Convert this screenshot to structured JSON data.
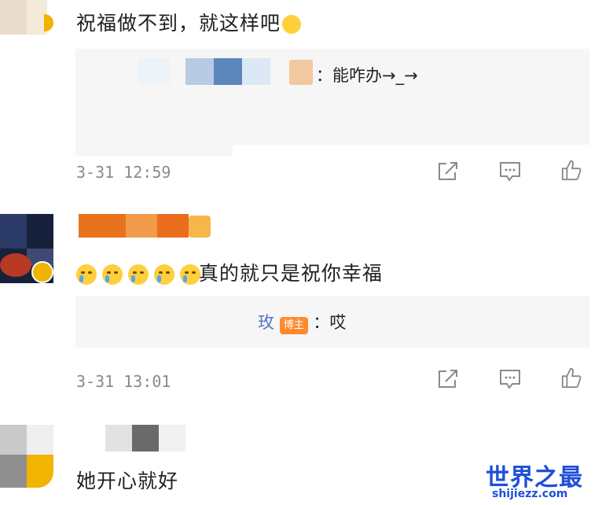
{
  "comments": [
    {
      "text": "祝福做不到，就这样吧",
      "reply": {
        "text": "：能咋办→_→"
      },
      "time": "3-31 12:59"
    },
    {
      "text": "真的就只是祝你幸福",
      "reply": {
        "author": "玫",
        "badge": "博主",
        "text": "：哎"
      },
      "time": "3-31 13:01"
    },
    {
      "text": "她开心就好"
    }
  ],
  "icons": {
    "share": "share-icon",
    "comment": "comment-icon",
    "like": "like-icon"
  },
  "colors": {
    "badge": "#ff8a2c",
    "watermark": "#1e4fd8"
  },
  "watermark": {
    "main": "世界之最",
    "sub": "shijiezz.com"
  }
}
